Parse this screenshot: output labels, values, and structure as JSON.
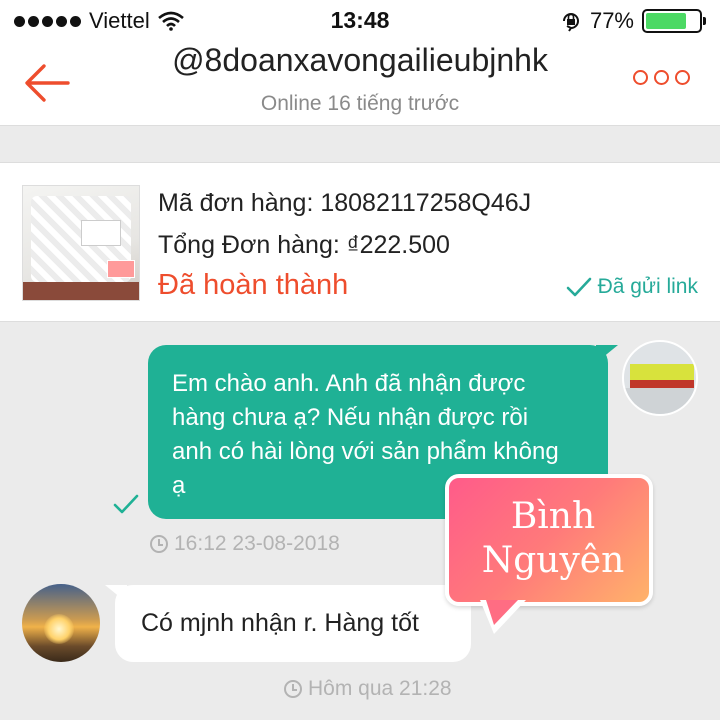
{
  "status_bar": {
    "carrier": "Viettel",
    "time": "13:48",
    "battery_percent": "77%",
    "battery_level": 0.77
  },
  "header": {
    "title": "@8doanxavongailieubjnhk",
    "subtitle": "Online 16 tiếng trước"
  },
  "order": {
    "id_text": "Mã đơn hàng: 18082117258Q46J",
    "total_text": "Tổng Đơn hàng: ₫222.500",
    "status": "Đã hoàn thành",
    "link_status": "Đã gửi link"
  },
  "messages": [
    {
      "direction": "out",
      "text": "Em chào anh. Anh đã nhận được hàng chưa ạ? Nếu nhận được rồi anh có hài lòng với sản phẩm không ạ",
      "time": "16:12 23-08-2018"
    },
    {
      "direction": "in",
      "text": "Có mjnh nhận r. Hàng tốt",
      "time": "Hôm qua 21:28"
    }
  ],
  "sticker": {
    "line1": "Bình",
    "line2": "Nguyên"
  },
  "colors": {
    "accent": "#ee4d2d",
    "outgoing_bubble": "#1fb195",
    "link_green": "#26aa99"
  }
}
